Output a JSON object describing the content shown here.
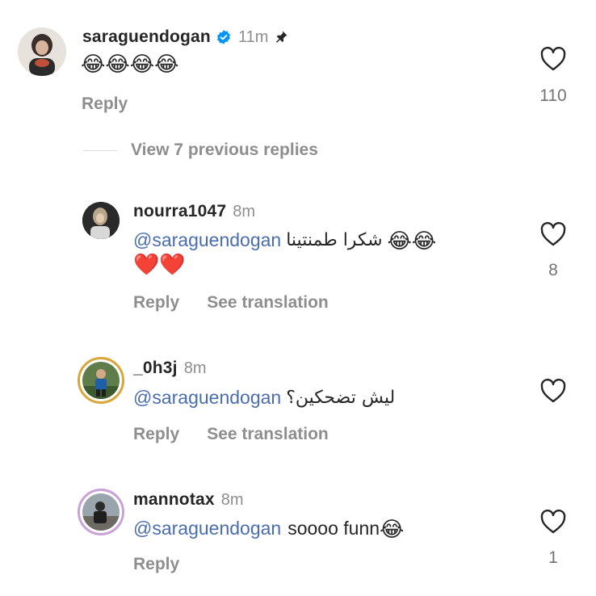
{
  "comment": {
    "username": "saraguendogan",
    "time": "11m",
    "text": "😂😂😂😂",
    "reply_label": "Reply",
    "likes": "110"
  },
  "view_replies": "View 7 previous replies",
  "replies": [
    {
      "username": "nourra1047",
      "time": "8m",
      "mention": "@saraguendogan",
      "text": "شكرا طمنتينا",
      "emoji": "😂😂",
      "second_line": "❤️❤️",
      "reply_label": "Reply",
      "translate_label": "See translation",
      "likes": "8"
    },
    {
      "username": "_0h3j",
      "time": "8m",
      "mention": "@saraguendogan",
      "text": "ليش تضحكين؟",
      "reply_label": "Reply",
      "translate_label": "See translation",
      "likes": ""
    },
    {
      "username": "mannotax",
      "time": "8m",
      "mention": "@saraguendogan",
      "text": "soooo funn",
      "emoji": "😂",
      "reply_label": "Reply",
      "likes": "1"
    }
  ],
  "icons": {
    "verified": "verified-badge-icon",
    "pin": "pin-icon",
    "like": "heart-outline-icon"
  },
  "colors": {
    "mention": "#4a6db0",
    "verified": "#0095f6",
    "muted": "#8e8e8e"
  }
}
